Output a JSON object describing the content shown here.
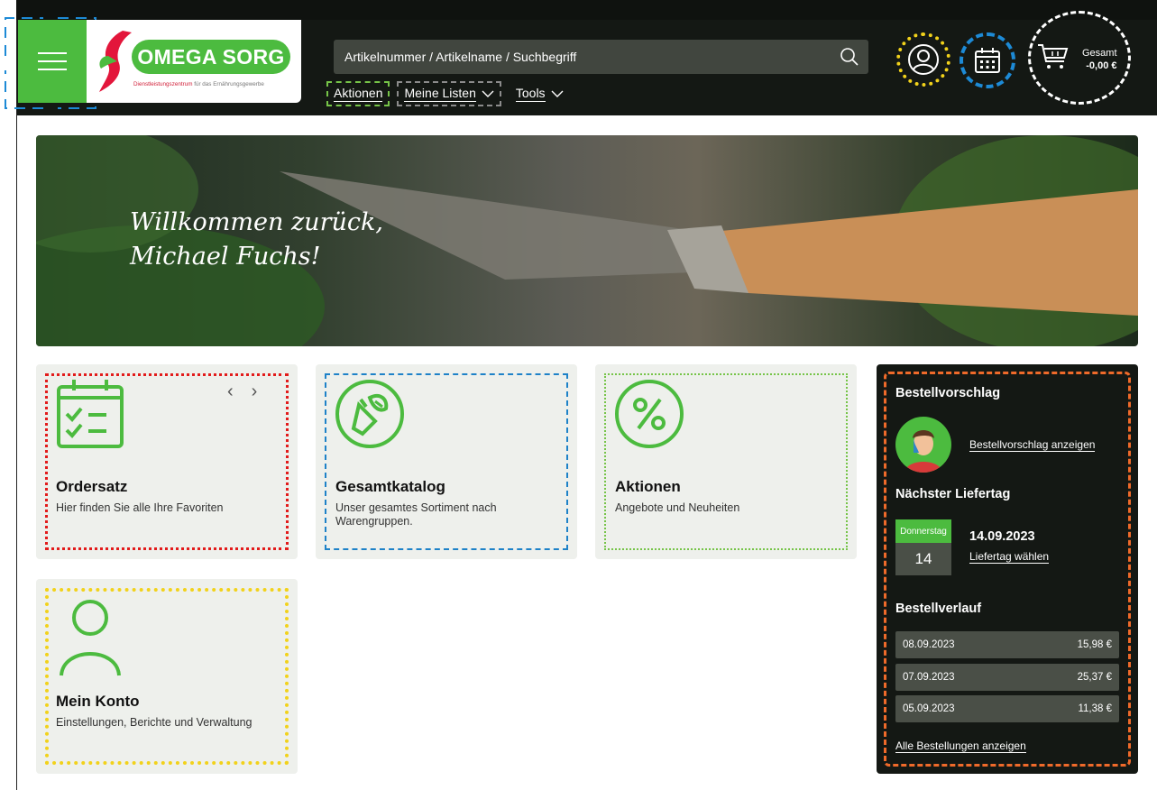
{
  "header": {
    "logo_text": "OMEGA SORG",
    "logo_tagline_part1": "Dienstleistungszentrum",
    "logo_tagline_part2": "für das Ernährungsgewerbe",
    "search_placeholder": "Artikelnummer / Artikelname / Suchbegriff",
    "nav": [
      {
        "label": "Aktionen"
      },
      {
        "label": "Meine Listen"
      },
      {
        "label": "Tools"
      }
    ],
    "cart": {
      "label": "Gesamt",
      "amount": "-0,00 €"
    }
  },
  "hero": {
    "greeting_line1": "Willkommen zurück,",
    "greeting_line2": "Michael Fuchs!"
  },
  "tiles": [
    {
      "title": "Ordersatz",
      "desc": "Hier finden Sie alle Ihre Favoriten",
      "icon": "calendar-check-icon"
    },
    {
      "title": "Gesamtkatalog",
      "desc": "Unser gesamtes Sortiment nach Warengruppen.",
      "icon": "vegetables-icon"
    },
    {
      "title": "Aktionen",
      "desc": "Angebote und Neuheiten",
      "icon": "percent-icon"
    },
    {
      "title": "Mein Konto",
      "desc": "Einstellungen, Berichte und Verwaltung",
      "icon": "user-icon"
    }
  ],
  "side_panel": {
    "suggestion_title": "Bestellvorschlag",
    "suggestion_link": "Bestellvorschlag anzeigen",
    "delivery_title": "Nächster Liefertag",
    "delivery_weekday": "Donnerstag",
    "delivery_day": "14",
    "delivery_date": "14.09.2023",
    "delivery_link": "Liefertag wählen",
    "history_title": "Bestellverlauf",
    "orders": [
      {
        "date": "08.09.2023",
        "amount": "15,98 €"
      },
      {
        "date": "07.09.2023",
        "amount": "25,37 €"
      },
      {
        "date": "05.09.2023",
        "amount": "11,38 €"
      }
    ],
    "all_orders_link": "Alle Bestellungen anzeigen"
  },
  "colors": {
    "brand_green": "#4cbb3f",
    "header_bg": "#141814",
    "accent_red": "#d2213a"
  }
}
